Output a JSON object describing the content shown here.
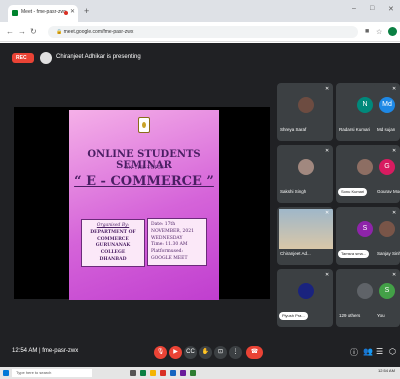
{
  "browser": {
    "tab_title": "Meet - fme-pasr-zwx",
    "address": "meet.google.com/fme-pasr-zwx",
    "window_minimize": "–",
    "window_restore": "□"
  },
  "meeting": {
    "rec_label": "REC",
    "presenter_text": "Chiranjeet Adhikar is presenting",
    "clock": "12:54 AM | fme-pasr-zwx",
    "meeting_code": "fme-pasr-zwx"
  },
  "slide": {
    "title": "ONLINE STUDENTS SEMINAR",
    "subtitle": "ON THE TOPIC",
    "topic": "“ E - COMMERCE ”",
    "organised_label": "Organised By:",
    "organiser_line1": "DEPARTMENT OF COMMERCE",
    "organiser_line2": "GURUNANAK COLLEGE",
    "organiser_line3": "DHANBAD",
    "date_line": "Date: 17th NOVEMBER, 2021",
    "day_line": "WEDNESDAY",
    "time_line": "Time: 11.30 AM",
    "platform_line": "Platformused: GOOGLE MEET"
  },
  "participants": [
    {
      "name": "Shreya Saraf",
      "initial": "",
      "color": "#6d4c41"
    },
    {
      "name": "Radarsi Kumari",
      "initial": "N",
      "color": "#00897b"
    },
    {
      "name": "Md sujan",
      "initial": "Md",
      "color": "#1e88e5"
    },
    {
      "name": "Sakshi Singh",
      "initial": "",
      "color": "#a1887f"
    },
    {
      "name": "Sonu Kumari",
      "initial": "",
      "color": "#8d6e63"
    },
    {
      "name": "Gourav Modi",
      "initial": "G",
      "color": "#d81b60"
    },
    {
      "name": "Chiranjeet Ad...",
      "initial": "",
      "color": "#90a4ae"
    },
    {
      "name": "Tamsra sma...",
      "initial": "S",
      "color": "#8e24aa"
    },
    {
      "name": "Sanjay Sinha",
      "initial": "",
      "color": "#795548"
    },
    {
      "name": "Piyush Pra...",
      "initial": "",
      "color": "#1a237e"
    },
    {
      "name": "129 others",
      "initial": "",
      "color": "#5f6368"
    },
    {
      "name": "You",
      "initial": "S",
      "color": "#43a047"
    }
  ],
  "taskbar": {
    "search_placeholder": "Type here to search",
    "time": "12:54 AM"
  },
  "colors": {
    "meet_bg": "#202124",
    "tile_bg": "#3c4043",
    "rec_red": "#ea4335",
    "slide_text": "#4a1e63"
  }
}
